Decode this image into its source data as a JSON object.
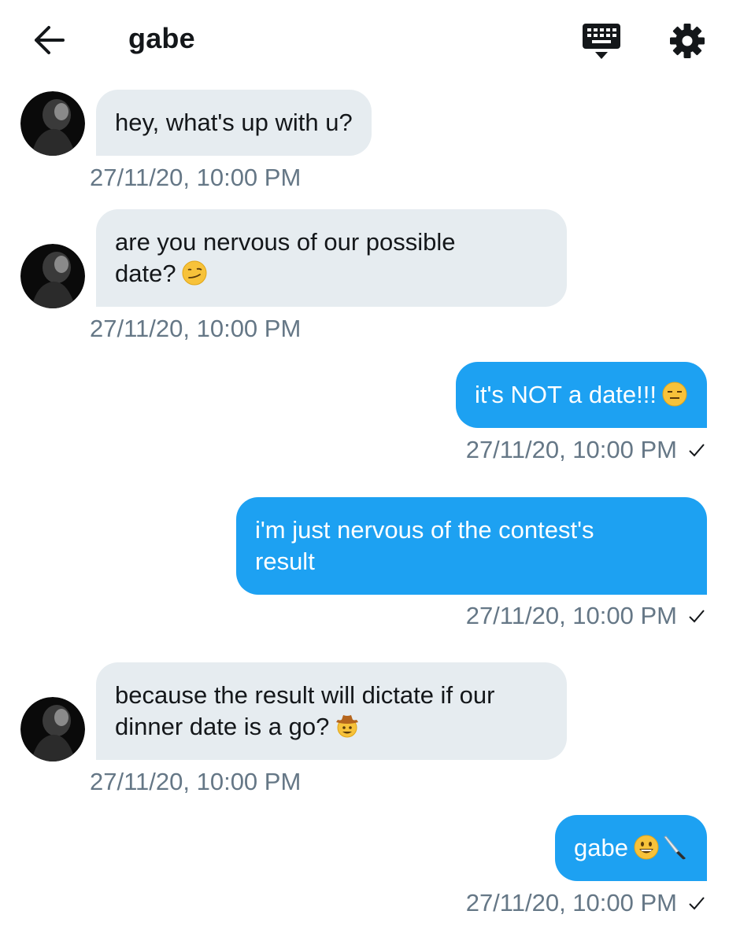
{
  "header": {
    "title": "gabe",
    "back_icon": "arrow-left-icon",
    "keyboard_icon": "keyboard-icon",
    "settings_icon": "gear-icon"
  },
  "colors": {
    "incoming_bubble": "#e6ecf0",
    "outgoing_bubble": "#1da1f2",
    "timestamp": "#657786"
  },
  "messages": [
    {
      "direction": "incoming",
      "lines": [
        "hey, what's up with u?"
      ],
      "timestamp": "27/11/20, 10:00 PM"
    },
    {
      "direction": "incoming",
      "lines": [
        "are you nervous of our possible",
        "date?"
      ],
      "emoji": "smirking-face-emoji",
      "timestamp": "27/11/20, 10:00 PM"
    },
    {
      "direction": "outgoing",
      "lines": [
        "it's NOT a date!!!"
      ],
      "emoji": "expressionless-face-emoji",
      "timestamp": "27/11/20, 10:00 PM",
      "read_icon": "checkmark-icon"
    },
    {
      "direction": "outgoing",
      "lines": [
        "i'm just nervous of the contest's",
        "result"
      ],
      "timestamp": "27/11/20, 10:00 PM",
      "read_icon": "checkmark-icon"
    },
    {
      "direction": "incoming",
      "lines": [
        "because the result will dictate if our",
        "dinner date is a go?"
      ],
      "emoji": "cowboy-hat-face-emoji",
      "timestamp": "27/11/20, 10:00 PM"
    },
    {
      "direction": "outgoing",
      "lines": [
        "gabe"
      ],
      "emoji": "grinning-face-and-knife-emoji",
      "timestamp": "27/11/20, 10:00 PM",
      "read_icon": "checkmark-icon"
    }
  ]
}
